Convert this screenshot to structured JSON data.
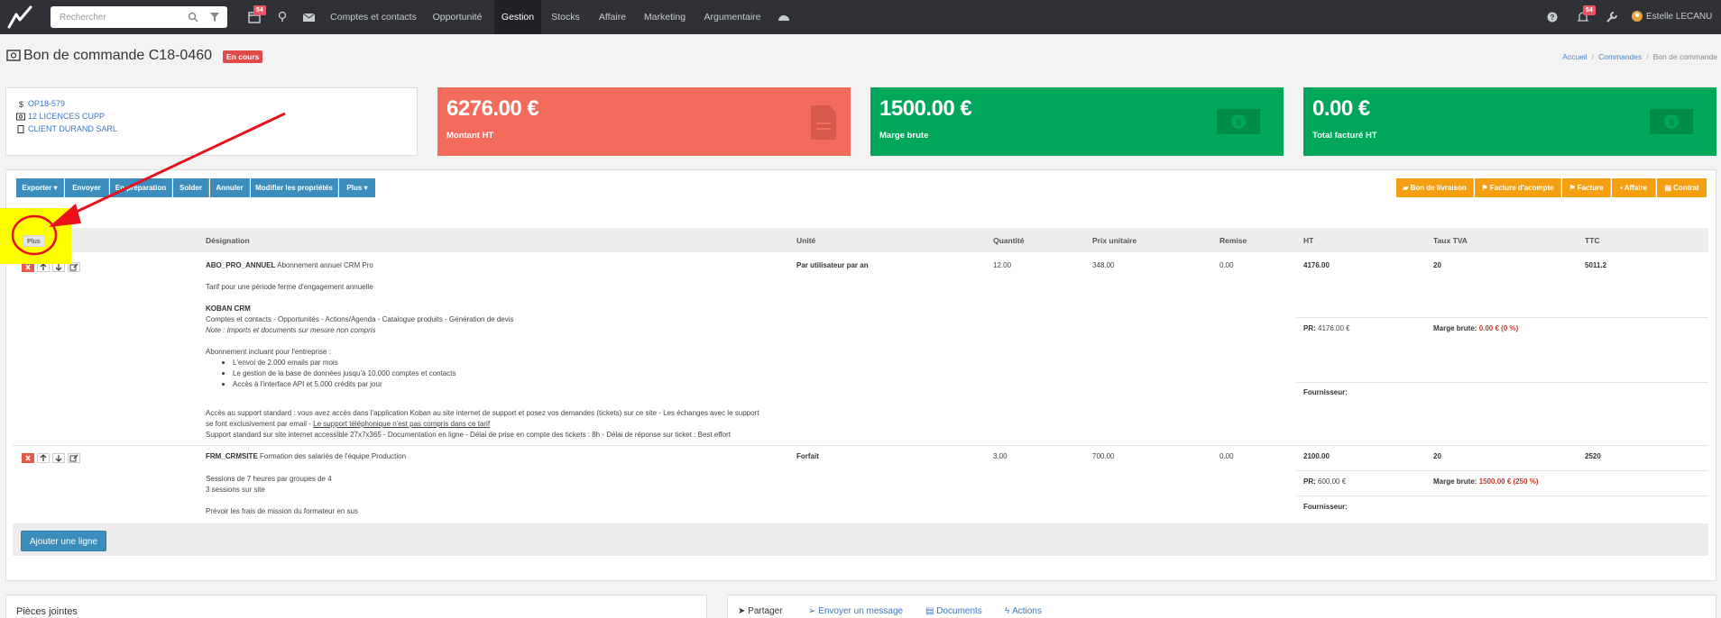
{
  "topbar": {
    "search_placeholder": "Rechercher",
    "calendar_badge": "54",
    "bell_badge": "54",
    "nav": [
      "Comptes et contacts",
      "Opportunité",
      "Gestion",
      "Stocks",
      "Affaire",
      "Marketing",
      "Argumentaire"
    ],
    "active_nav": "Gestion",
    "user_name": "Estelle LECANU"
  },
  "page": {
    "title": "Bon de commande C18-0460",
    "status": "En cours",
    "breadcrumb": [
      "Accueil",
      "Commandes",
      "Bon de commande"
    ]
  },
  "info": {
    "opportunity": "OP18-579",
    "product": "12 LICENCES CUPP",
    "client": "CLIENT DURAND SARL"
  },
  "kpis": [
    {
      "value": "6276.00 €",
      "label": "Montant HT",
      "color": "#f26b5b"
    },
    {
      "value": "1500.00 €",
      "label": "Marge brute",
      "color": "#00a65a"
    },
    {
      "value": "0.00 €",
      "label": "Total facturé HT",
      "color": "#00a65a"
    }
  ],
  "toolbar": {
    "left": [
      "Exporter ▾",
      "Envoyer",
      "En préparation",
      "Solder",
      "Annuler",
      "Modifier les propriétés",
      "Plus ▾"
    ],
    "right": [
      "Bon de livraison",
      "Facture d'acompte",
      "Facture",
      "Affaire",
      "Contrat"
    ]
  },
  "highlight_label": "Plus",
  "table": {
    "headers": [
      "Désignation",
      "Unité",
      "Quantité",
      "Prix unitaire",
      "Remise",
      "HT",
      "Taux TVA",
      "TTC"
    ],
    "rows": [
      {
        "code": "ABO_PRO_ANNUEL",
        "name": "Abonnement annuel CRM Pro",
        "unit": "Par utilisateur par an",
        "qty": "12.00",
        "price": "348.00",
        "discount": "0.00",
        "ht": "4176.00",
        "vat": "20",
        "ttc": "5011.2",
        "pr_label": "PR:",
        "pr": "4176.00 €",
        "margin_label": "Marge brute:",
        "margin": "0.00 € (0 %)",
        "supplier_label": "Fournisseur:",
        "desc": {
          "l1": "Tarif pour une période ferme d'engagement annuelle",
          "l2": "KOBAN CRM",
          "l3": "Comptes et contacts - Opportunités - Actions/Agenda - Catalogue produits - Génération de devis",
          "l4": "Note : Imports et documents sur mesure non compris",
          "l5": "Abonnement incluant pour l'entreprise :",
          "b1": "L'envoi de 2.000 emails par mois",
          "b2": "Le gestion de la base de données jusqu'à 10.000 comptes et contacts",
          "b3": "Accès à l'interface API et 5.000 crédits par jour",
          "l6": "Accès au support standard : vous avez accès dans l'application Koban au site internet de support et posez vos demandes (tickets) sur ce site - Les échanges avec le support",
          "l7a": "se font exclusivement par email - ",
          "l7b": "Le support téléphonique n'est pas compris dans ce tarif",
          "l8": "Support standard sur site internet accessible 27x7x365 - Documentation en ligne - Délai de prise en compte des tickets : 8h - Délai de réponse sur ticket : Best effort"
        }
      },
      {
        "code": "FRM_CRMSITE",
        "name": "Formation des salariés de l'équipe Production",
        "unit": "Forfait",
        "qty": "3.00",
        "price": "700.00",
        "discount": "0.00",
        "ht": "2100.00",
        "vat": "20",
        "ttc": "2520",
        "pr_label": "PR:",
        "pr": "600.00 €",
        "margin_label": "Marge brute:",
        "margin": "1500.00 € (250 %)",
        "supplier_label": "Fournisseur:",
        "desc": {
          "l1": "Sessions de 7 heures par groupes de 4",
          "l2": "3 sessions sur site",
          "l3": "Prévoir les frais de mission du formateur en sus"
        }
      }
    ]
  },
  "add_line_label": "Ajouter une ligne",
  "bottom": {
    "attachments_title": "Pièces jointes",
    "tabs": [
      "Partager",
      "Envoyer un message",
      "Documents",
      "Actions"
    ]
  },
  "colors": {
    "annotation_red": "#e8111b",
    "highlight": "#ffff00",
    "topbar": "#2f3136",
    "primary": "#3c8dbc",
    "orange": "#f4a012"
  }
}
